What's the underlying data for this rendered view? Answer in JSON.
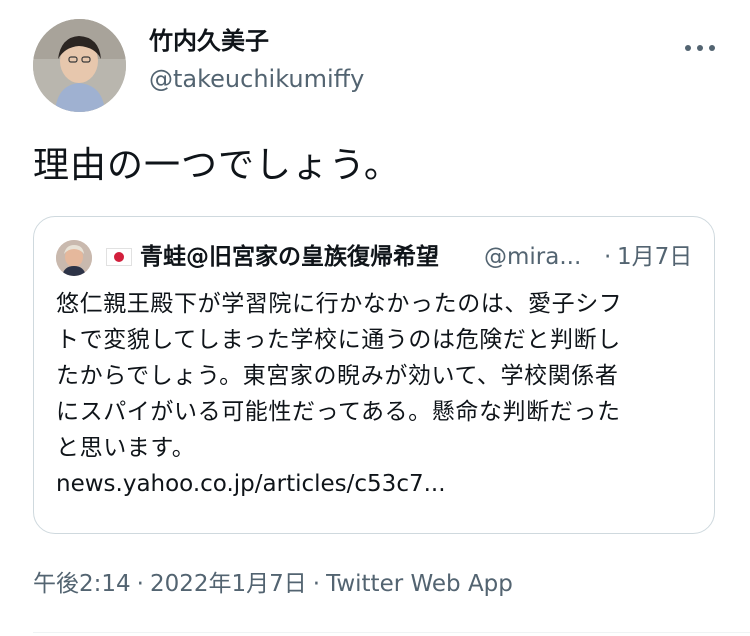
{
  "author": {
    "display_name": "竹内久美子",
    "handle": "@takeuchikumiffy",
    "avatar_icon": "profile-photo"
  },
  "more_icon": "more-horizontal-icon",
  "tweet": {
    "text": "理由の一つでしょう。"
  },
  "quote": {
    "avatar_icon": "profile-photo",
    "flag_icon": "japan-flag-icon",
    "display_name": "青蛙@旧宮家の皇族復帰希望",
    "handle": "@mira...",
    "separator": "·",
    "date": "1月7日",
    "lines": [
      "悠仁親王殿下が学習院に行かなかったのは、愛子シフ",
      "トで変貌してしまった学校に通うのは危険だと判断し",
      "たからでしょう。東宮家の睨みが効いて、学校関係者",
      "にスパイがいる可能性だってある。懸命な判断だった",
      "と思います。"
    ],
    "link": "news.yahoo.co.jp/articles/c53c7..."
  },
  "meta": {
    "time": "午後2:14",
    "separator1": "·",
    "date": "2022年1月7日",
    "separator2": "·",
    "source": "Twitter Web App"
  },
  "colors": {
    "text": "#0f1419",
    "secondary": "#536471",
    "border": "#cfd9de",
    "flag_red": "#d21f3c"
  }
}
